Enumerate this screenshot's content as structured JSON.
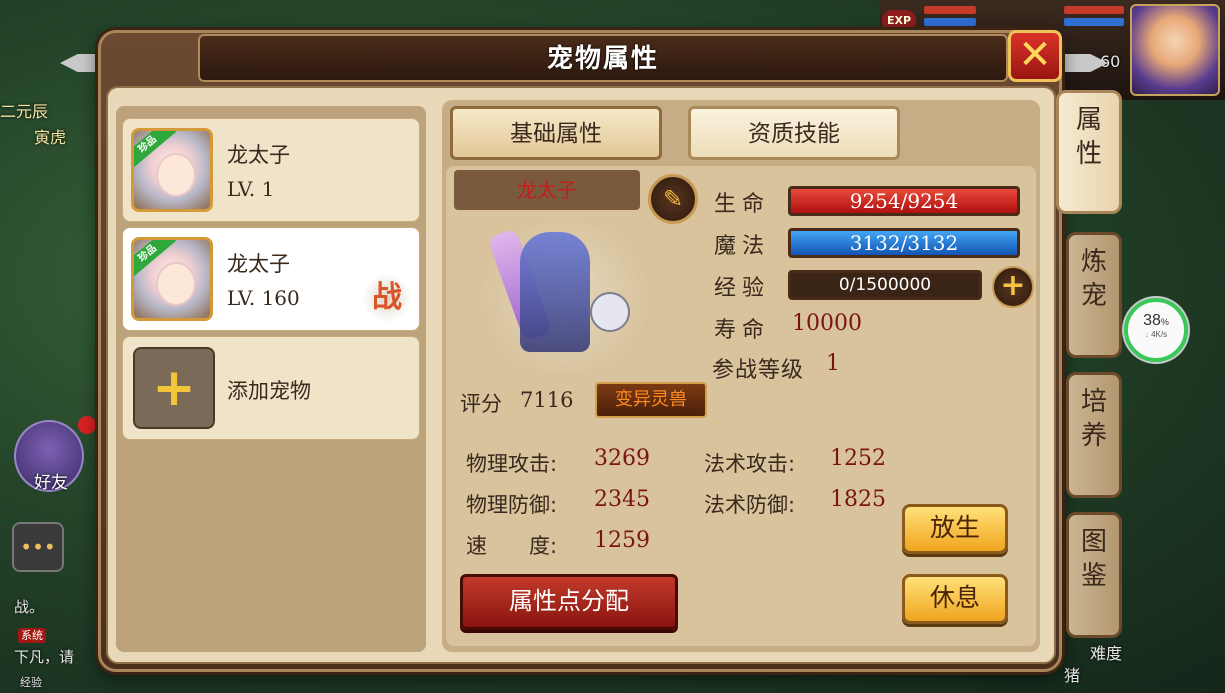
{
  "scene": {
    "exp_badge": "EXP",
    "left_texts": [
      "二元辰",
      "寅虎"
    ],
    "friend_label": "好友",
    "chat_icon": "chat-bubble-icon",
    "bottom_lines": [
      "战。",
      "下凡，请"
    ],
    "sys_tag": "系统",
    "level_hint": "60",
    "bottom_right_texts": [
      "难度",
      "猪"
    ],
    "bottom_exp_label": "经验"
  },
  "network": {
    "percent": "38",
    "percent_unit": "%",
    "speed": "4K/s"
  },
  "dialog": {
    "title": "宠物属性",
    "close_icon": "close-x-icon"
  },
  "pets": [
    {
      "tag": "珍品",
      "name": "龙太子",
      "level": "LV. 1",
      "battle": ""
    },
    {
      "tag": "珍品",
      "name": "龙太子",
      "level": "LV. 160",
      "battle": "战"
    }
  ],
  "add_pet": {
    "icon": "+",
    "label": "添加宠物"
  },
  "tabs": {
    "basic": "基础属性",
    "talent": "资质技能"
  },
  "detail": {
    "name": "龙太子",
    "stats": [
      {
        "label": "生命",
        "value": "9254/9254"
      },
      {
        "label": "魔法",
        "value": "3132/3132"
      },
      {
        "label": "经验",
        "value": "0/1500000"
      }
    ],
    "life_label": "寿命",
    "life_value": "10000",
    "battle_level_label": "参战等级",
    "battle_level_value": "1",
    "score_label": "评分",
    "score_value": "7116",
    "mutant_tag": "变异灵兽",
    "attributes": [
      {
        "label": "物理攻击:",
        "value": "3269"
      },
      {
        "label": "法术攻击:",
        "value": "1252"
      },
      {
        "label": "物理防御:",
        "value": "2345"
      },
      {
        "label": "法术防御:",
        "value": "1825"
      },
      {
        "label": "速　　度:",
        "value": "1259"
      }
    ],
    "release_button": "放生",
    "rest_button": "休息",
    "allocate_button": "属性点分配"
  },
  "side_tabs": [
    {
      "label_1": "属",
      "label_2": "性"
    },
    {
      "label_1": "炼",
      "label_2": "宠"
    },
    {
      "label_1": "培",
      "label_2": "养"
    },
    {
      "label_1": "图",
      "label_2": "鉴"
    }
  ],
  "colors": {
    "hp": "#b01010",
    "mp": "#1254b5",
    "accent_gold": "#f0a51e",
    "value_red": "#7a1414"
  }
}
